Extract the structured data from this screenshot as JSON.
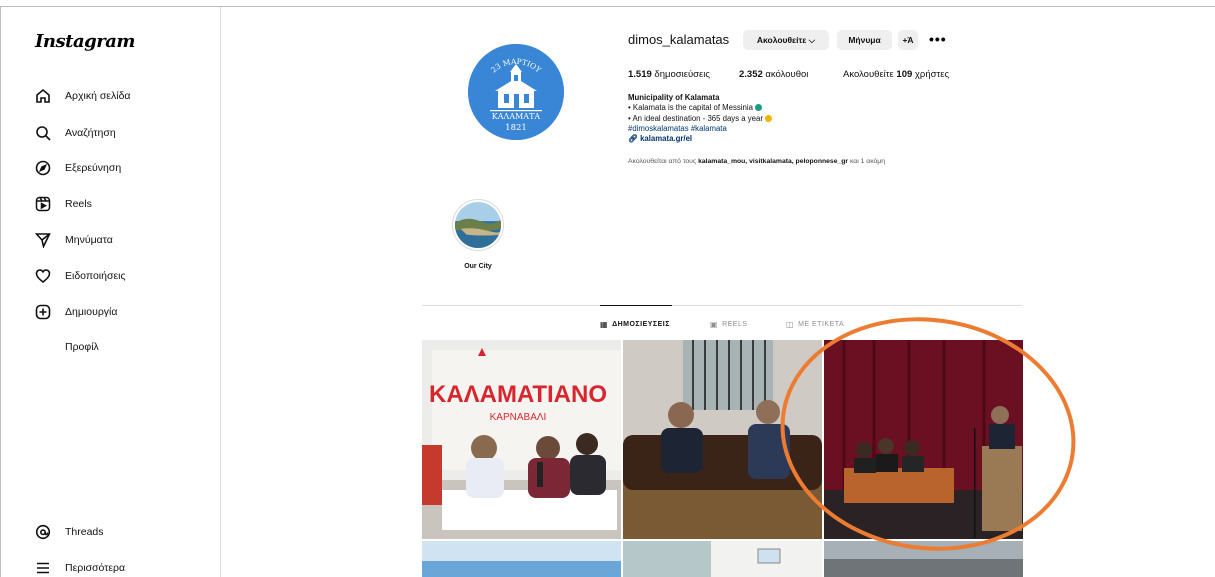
{
  "app": {
    "logo": "Instagram"
  },
  "sidebar": {
    "items": [
      {
        "label": "Αρχική σελίδα",
        "icon": "home-icon"
      },
      {
        "label": "Αναζήτηση",
        "icon": "search-icon"
      },
      {
        "label": "Εξερεύνηση",
        "icon": "compass-icon"
      },
      {
        "label": "Reels",
        "icon": "reels-icon"
      },
      {
        "label": "Μηνύματα",
        "icon": "messages-icon"
      },
      {
        "label": "Ειδοποιήσεις",
        "icon": "heart-icon"
      },
      {
        "label": "Δημιουργία",
        "icon": "create-icon"
      },
      {
        "label": "Προφίλ",
        "icon": "profile-icon"
      }
    ],
    "bottom": [
      {
        "label": "Threads",
        "icon": "threads-icon"
      },
      {
        "label": "Περισσότερα",
        "icon": "menu-icon"
      }
    ]
  },
  "profile": {
    "username": "dimos_kalamatas",
    "follow_label": "Ακολουθείτε ⌵",
    "message_label": "Μήνυμα",
    "add_user_label": "+Ά",
    "more_label": "•••",
    "posts_count": "1.519",
    "posts_label": "δημοσιεύσεις",
    "followers_count": "2.352",
    "followers_label": "ακόλουθοι",
    "following_prefix": "Ακολουθείτε",
    "following_count": "109",
    "following_label": "χρήστες",
    "avatar_text_top": "23 ΜΑΡΤΙΟΥ",
    "avatar_text_city": "ΚΑΛΑΜΑΤΑ",
    "avatar_text_year": "1821",
    "bio_name": "Municipality of Kalamata",
    "bio_line1": "• Kalamata is the capital of Messinia",
    "bio_line2": "• An ideal destination - 365 days a year",
    "bio_tags": "#dimoskalamatas #kalamata",
    "bio_link": "kalamata.gr/el",
    "followed_by_prefix": "Ακολουθείται από τους",
    "followed_by_names": "kalamata_mou, visitkalamata, peloponnese_gr",
    "followed_by_suffix": "και 1 ακόμη",
    "colors": {
      "accent_blue": "#3a86d6",
      "dot_green": "#1a9c80",
      "dot_yellow": "#f5b301",
      "annotation": "#ec7c31"
    }
  },
  "highlights": [
    {
      "label": "Our City"
    }
  ],
  "tabs": [
    {
      "label": "ΔΗΜΟΣΙΕΥΣΕΙΣ",
      "icon": "grid-icon",
      "active": true
    },
    {
      "label": "REELS",
      "icon": "reels-tab-icon",
      "active": false
    },
    {
      "label": "ΜΕ ΕΤΙΚΕΤΑ",
      "icon": "tagged-icon",
      "active": false
    }
  ],
  "posts": [
    {
      "banner": "ΚΑΛΑΜΑΤΙΑΝΟ",
      "sub": "ΚΑΡΝΑΒΑΛΙ"
    },
    {
      "banner": ""
    },
    {
      "banner": ""
    }
  ]
}
